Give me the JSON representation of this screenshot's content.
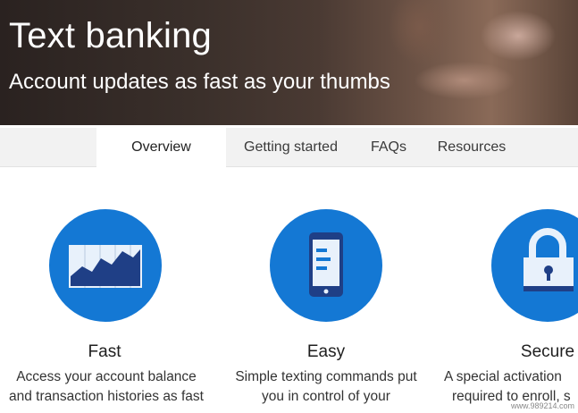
{
  "hero": {
    "title": "Text banking",
    "subtitle": "Account updates as fast as your thumbs"
  },
  "tabs": [
    {
      "label": "Overview",
      "active": true
    },
    {
      "label": "Getting started",
      "active": false
    },
    {
      "label": "FAQs",
      "active": false
    },
    {
      "label": "Resources",
      "active": false
    }
  ],
  "features": [
    {
      "icon": "chart-icon",
      "title": "Fast",
      "desc_line1": "Access your account balance",
      "desc_line2": "and transaction histories as fast"
    },
    {
      "icon": "phone-icon",
      "title": "Easy",
      "desc_line1": "Simple texting commands put",
      "desc_line2": "you in control of your"
    },
    {
      "icon": "lock-icon",
      "title": "Secure",
      "desc_line1": "A special activation",
      "desc_line2": "required to enroll, s"
    }
  ],
  "colors": {
    "accent": "#1478d4",
    "icon_navy": "#1f3f86",
    "icon_light": "#e8f1fb"
  },
  "watermark": "www.989214.com"
}
